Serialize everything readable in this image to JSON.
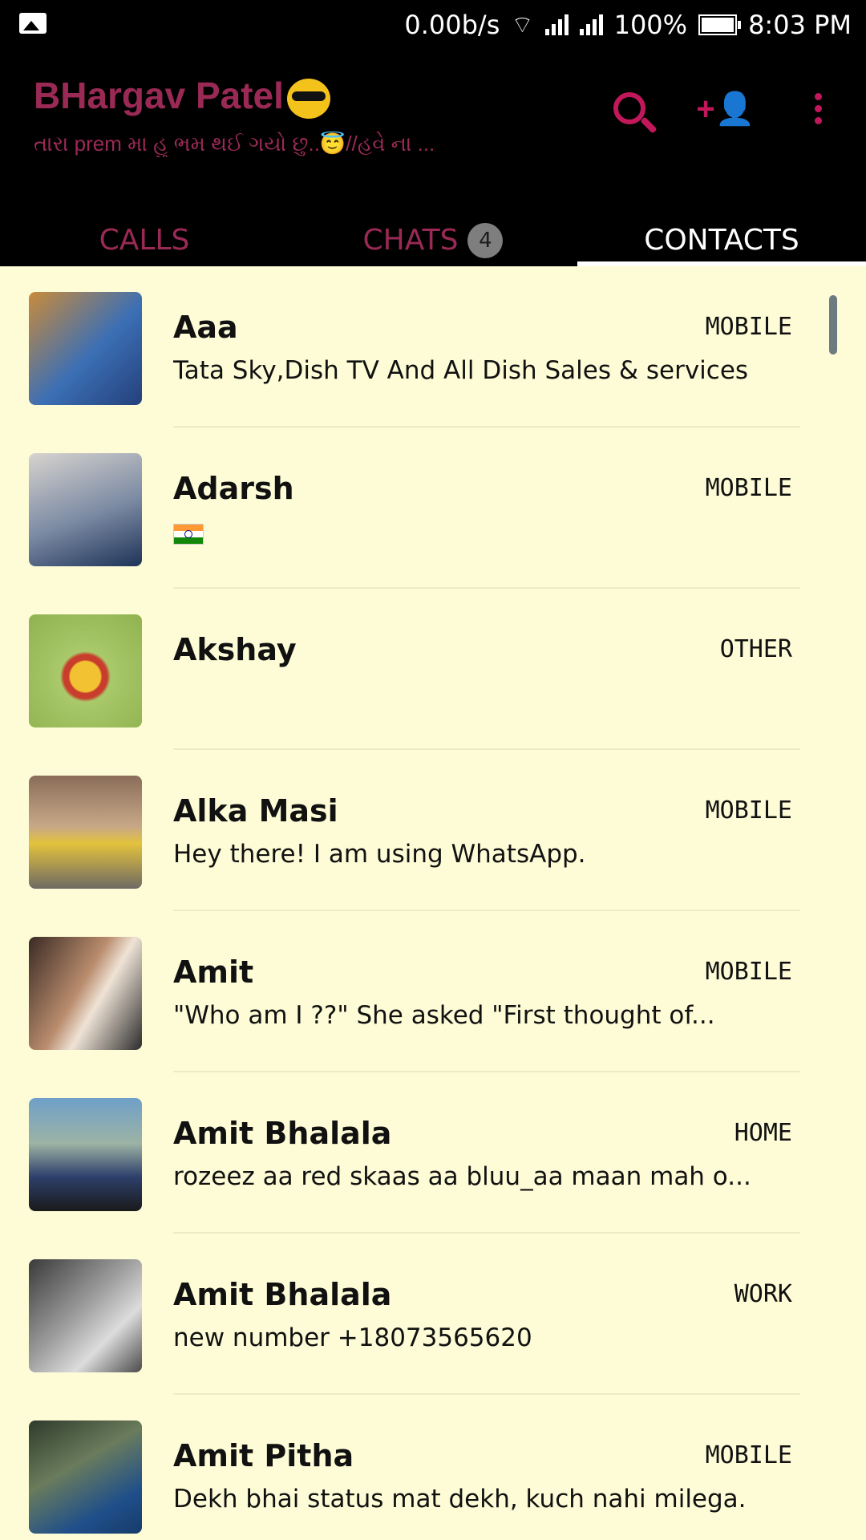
{
  "status_bar": {
    "speed": "0.00b/s",
    "battery": "100%",
    "time": "8:03 PM"
  },
  "header": {
    "title": "BHargav Patel",
    "subtitle": "તારા prem મા હુ ભમ થઈ ગયો છુ..😇//હવે ના ...",
    "icons": [
      "search-icon",
      "add-contact-icon",
      "more-vert-icon"
    ],
    "accent_color": "#9a2a55"
  },
  "tabs": [
    {
      "label": "CALLS"
    },
    {
      "label": "CHATS",
      "badge": "4"
    },
    {
      "label": "CONTACTS",
      "active": true
    }
  ],
  "contacts": [
    {
      "name": "Aaa",
      "type": "MOBILE",
      "status": "Tata Sky,Dish TV And All Dish Sales & services"
    },
    {
      "name": "Adarsh",
      "type": "MOBILE",
      "status": "",
      "status_icon": "india-flag-icon"
    },
    {
      "name": "Akshay",
      "type": "OTHER",
      "status": ""
    },
    {
      "name": "Alka Masi",
      "type": "MOBILE",
      "status": "Hey there! I am using WhatsApp."
    },
    {
      "name": "Amit",
      "type": "MOBILE",
      "status": "\"Who am I ??\"  She asked  \"First thought of..."
    },
    {
      "name": "Amit Bhalala",
      "type": "HOME",
      "status": "rozeez aa red skaas aa bluu_aa maan mah o..."
    },
    {
      "name": "Amit Bhalala",
      "type": "WORK",
      "status": "new number +18073565620"
    },
    {
      "name": "Amit Pitha",
      "type": "MOBILE",
      "status": "Dekh bhai status mat dekh, kuch nahi milega."
    }
  ]
}
